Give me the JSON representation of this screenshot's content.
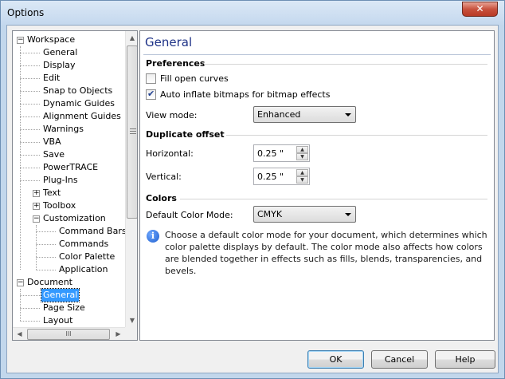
{
  "window": {
    "title": "Options",
    "close_label": "✕"
  },
  "tree": {
    "items": [
      {
        "label": "Workspace",
        "level": 0,
        "expander": "−"
      },
      {
        "label": "General",
        "level": 1
      },
      {
        "label": "Display",
        "level": 1
      },
      {
        "label": "Edit",
        "level": 1
      },
      {
        "label": "Snap to Objects",
        "level": 1
      },
      {
        "label": "Dynamic Guides",
        "level": 1
      },
      {
        "label": "Alignment Guides",
        "level": 1
      },
      {
        "label": "Warnings",
        "level": 1
      },
      {
        "label": "VBA",
        "level": 1
      },
      {
        "label": "Save",
        "level": 1
      },
      {
        "label": "PowerTRACE",
        "level": 1
      },
      {
        "label": "Plug-Ins",
        "level": 1
      },
      {
        "label": "Text",
        "level": 1,
        "expander": "+"
      },
      {
        "label": "Toolbox",
        "level": 1,
        "expander": "+"
      },
      {
        "label": "Customization",
        "level": 1,
        "expander": "−"
      },
      {
        "label": "Command Bars",
        "level": 2
      },
      {
        "label": "Commands",
        "level": 2
      },
      {
        "label": "Color Palette",
        "level": 2
      },
      {
        "label": "Application",
        "level": 2
      },
      {
        "label": "Document",
        "level": 0,
        "expander": "−"
      },
      {
        "label": "General",
        "level": 1,
        "selected": true
      },
      {
        "label": "Page Size",
        "level": 1
      },
      {
        "label": "Layout",
        "level": 1
      }
    ],
    "hscroll_grip": "III",
    "arrows": {
      "up": "▲",
      "down": "▼",
      "left": "◀",
      "right": "▶"
    }
  },
  "panel": {
    "title": "General",
    "preferences": {
      "heading": "Preferences",
      "fill_open_curves": {
        "label": "Fill open curves",
        "checked": false
      },
      "auto_inflate": {
        "label": "Auto inflate bitmaps for bitmap effects",
        "checked": true
      },
      "view_mode": {
        "label": "View mode:",
        "value": "Enhanced"
      }
    },
    "duplicate_offset": {
      "heading": "Duplicate offset",
      "horizontal": {
        "label": "Horizontal:",
        "value": "0.25 \""
      },
      "vertical": {
        "label": "Vertical:",
        "value": "0.25 \""
      }
    },
    "colors": {
      "heading": "Colors",
      "default_mode": {
        "label": "Default Color Mode:",
        "value": "CMYK"
      },
      "info_icon": "i",
      "info_text": "Choose a default color mode for your document, which determines which color palette displays by default. The color mode also affects how colors are blended together in effects such as fills, blends, transparencies, and bevels."
    }
  },
  "buttons": {
    "ok": "OK",
    "cancel": "Cancel",
    "help": "Help"
  },
  "colors": {
    "selection": "#3399ff",
    "title_blue": "#1e3287",
    "close_red": "#c8523e"
  }
}
